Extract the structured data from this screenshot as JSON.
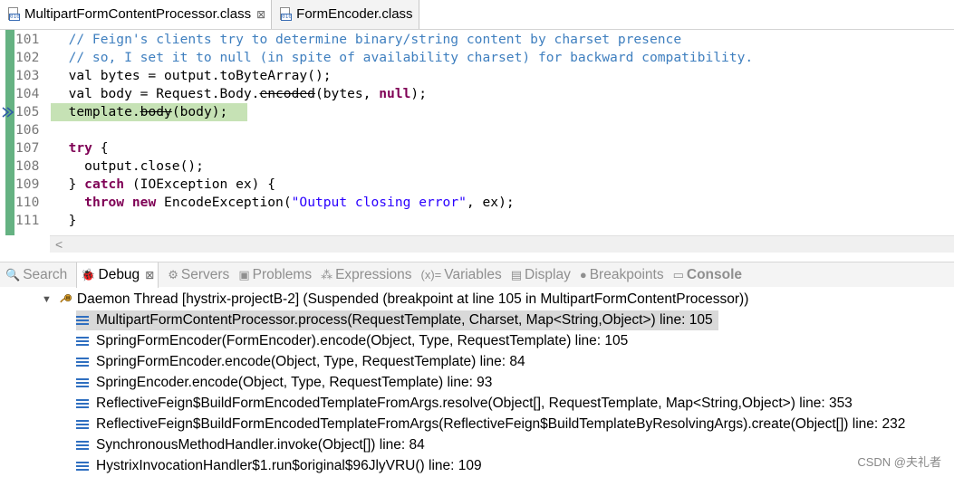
{
  "editor_tabs": [
    {
      "label": "MultipartFormContentProcessor.class",
      "active": true,
      "close": "⊠"
    },
    {
      "label": "FormEncoder.class",
      "active": false
    }
  ],
  "code": {
    "lines": [
      {
        "num": "101",
        "parts": [
          {
            "t": "  // Feign's clients try to determine binary/string content by charset presence",
            "c": "cm"
          }
        ]
      },
      {
        "num": "102",
        "parts": [
          {
            "t": "  // so, I set it to null (in spite of availability charset) for backward compatibility.",
            "c": "cm"
          }
        ]
      },
      {
        "num": "103",
        "parts": [
          {
            "t": "  val bytes = output.toByteArray();",
            "c": "fld"
          }
        ]
      },
      {
        "num": "104",
        "parts": [
          {
            "t": "  val body = Request.Body.",
            "c": "fld"
          },
          {
            "t": "encoded",
            "c": "fld strike"
          },
          {
            "t": "(bytes, ",
            "c": "fld"
          },
          {
            "t": "null",
            "c": "kw"
          },
          {
            "t": ");",
            "c": "fld"
          }
        ]
      },
      {
        "num": "105",
        "parts": [
          {
            "t": "  template.",
            "c": "fld"
          },
          {
            "t": "body",
            "c": "fld strike"
          },
          {
            "t": "(body);",
            "c": "fld"
          }
        ],
        "highlight": true
      },
      {
        "num": "106",
        "parts": [
          {
            "t": "",
            "c": "fld"
          }
        ]
      },
      {
        "num": "107",
        "parts": [
          {
            "t": "  ",
            "c": "fld"
          },
          {
            "t": "try",
            "c": "kw"
          },
          {
            "t": " {",
            "c": "fld"
          }
        ]
      },
      {
        "num": "108",
        "parts": [
          {
            "t": "    output.close();",
            "c": "fld"
          }
        ]
      },
      {
        "num": "109",
        "parts": [
          {
            "t": "  } ",
            "c": "fld"
          },
          {
            "t": "catch",
            "c": "kw"
          },
          {
            "t": " (IOException ex) {",
            "c": "fld"
          }
        ]
      },
      {
        "num": "110",
        "parts": [
          {
            "t": "    ",
            "c": "fld"
          },
          {
            "t": "throw",
            "c": "kw"
          },
          {
            "t": " ",
            "c": "fld"
          },
          {
            "t": "new",
            "c": "kw"
          },
          {
            "t": " EncodeException(",
            "c": "fld"
          },
          {
            "t": "\"Output closing error\"",
            "c": "str"
          },
          {
            "t": ", ex);",
            "c": "fld"
          }
        ]
      },
      {
        "num": "111",
        "parts": [
          {
            "t": "  }",
            "c": "fld"
          }
        ]
      }
    ]
  },
  "view_tabs": [
    {
      "label": "Search",
      "icon": "🔍",
      "active": false
    },
    {
      "label": "Debug",
      "icon": "🐞",
      "active": true,
      "close": "⊠"
    },
    {
      "label": "Servers",
      "icon": "⚙",
      "active": false
    },
    {
      "label": "Problems",
      "icon": "▣",
      "active": false
    },
    {
      "label": "Expressions",
      "icon": "⁂",
      "active": false
    },
    {
      "label": "Variables",
      "icon": "(x)=",
      "active": false
    },
    {
      "label": "Display",
      "icon": "▤",
      "active": false
    },
    {
      "label": "Breakpoints",
      "icon": "●",
      "active": false
    },
    {
      "label": "Console",
      "icon": "▭",
      "active": false
    }
  ],
  "debug": {
    "thread": "Daemon Thread [hystrix-projectB-2] (Suspended (breakpoint at line 105 in MultipartFormContentProcessor))",
    "frames": [
      {
        "text": "MultipartFormContentProcessor.process(RequestTemplate, Charset, Map<String,Object>) line: 105",
        "selected": true
      },
      {
        "text": "SpringFormEncoder(FormEncoder).encode(Object, Type, RequestTemplate) line: 105"
      },
      {
        "text": "SpringFormEncoder.encode(Object, Type, RequestTemplate) line: 84"
      },
      {
        "text": "SpringEncoder.encode(Object, Type, RequestTemplate) line: 93"
      },
      {
        "text": "ReflectiveFeign$BuildFormEncodedTemplateFromArgs.resolve(Object[], RequestTemplate, Map<String,Object>) line: 353"
      },
      {
        "text": "ReflectiveFeign$BuildFormEncodedTemplateFromArgs(ReflectiveFeign$BuildTemplateByResolvingArgs).create(Object[]) line: 232"
      },
      {
        "text": "SynchronousMethodHandler.invoke(Object[]) line: 84"
      },
      {
        "text": "HystrixInvocationHandler$1.run$original$96JlyVRU() line: 109"
      }
    ]
  },
  "watermark": "CSDN @夫礼者"
}
